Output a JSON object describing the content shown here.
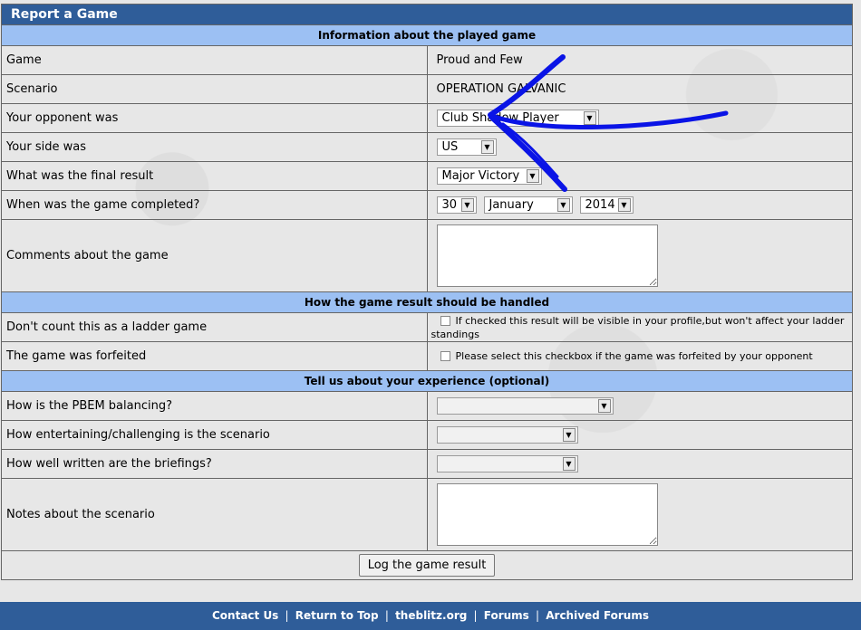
{
  "title": "Report a Game",
  "sections": {
    "info": "Information about the played game",
    "handling": "How the game result should be handled",
    "experience": "Tell us about your experience (optional)"
  },
  "fields": {
    "game": {
      "label": "Game",
      "value": "Proud and Few"
    },
    "scenario": {
      "label": "Scenario",
      "value": "OPERATION GALVANIC"
    },
    "opponent": {
      "label": "Your opponent was",
      "value": "Club Shadow Player"
    },
    "side": {
      "label": "Your side was",
      "value": "US"
    },
    "result": {
      "label": "What was the final result",
      "value": "Major Victory"
    },
    "completed": {
      "label": "When was the game completed?",
      "day": "30",
      "month": "January",
      "year": "2014"
    },
    "comments": {
      "label": "Comments about the game"
    },
    "no_ladder": {
      "label": "Don't count this as a ladder game",
      "note": "If checked this result will be visible in your profile,but won't affect your ladder standings"
    },
    "forfeited": {
      "label": "The game was forfeited",
      "note": "Please select this checkbox if the game was forfeited by your opponent"
    },
    "balancing": {
      "label": "How is the PBEM balancing?"
    },
    "entertaining": {
      "label": "How entertaining/challenging is the scenario"
    },
    "briefings": {
      "label": "How well written are the briefings?"
    },
    "notes": {
      "label": "Notes about the scenario"
    }
  },
  "submit_label": "Log the game result",
  "footer": {
    "links": [
      "Contact Us",
      "Return to Top",
      "theblitz.org",
      "Forums",
      "Archived Forums"
    ],
    "separator": "|"
  },
  "colors": {
    "header_bg": "#2f5d99",
    "section_bg": "#9cc0f3",
    "annotation": "#0a14e6"
  }
}
